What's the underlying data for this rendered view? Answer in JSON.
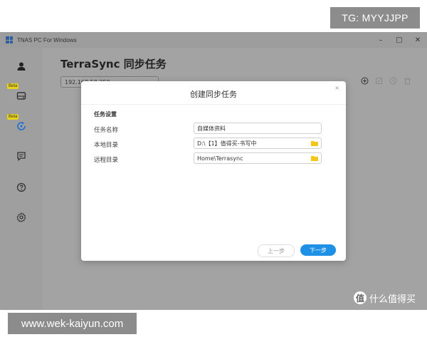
{
  "watermarks": {
    "top": "TG: MYYJJPP",
    "bottom": "www.wek-kaiyun.com",
    "brand": "什么值得买",
    "brand_logo": "值"
  },
  "window": {
    "title": "TNAS PC For Windows",
    "controls": {
      "minimize": "–",
      "maximize": "□",
      "close": "✕"
    }
  },
  "sidebar": {
    "items": [
      {
        "icon": "user-icon",
        "beta": ""
      },
      {
        "icon": "drive-icon",
        "beta": "Beta"
      },
      {
        "icon": "sync-icon",
        "beta": "Beta"
      },
      {
        "icon": "message-icon",
        "beta": ""
      },
      {
        "icon": "help-icon",
        "beta": ""
      },
      {
        "icon": "gear-icon",
        "beta": ""
      }
    ]
  },
  "main": {
    "title": "TerraSync 同步任务",
    "ip": "192.168.50.250",
    "toolbar": [
      "add-icon",
      "edit-icon",
      "history-icon",
      "delete-icon"
    ]
  },
  "modal": {
    "title": "创建同步任务",
    "close": "×",
    "section": "任务设置",
    "fields": [
      {
        "label": "任务名称",
        "value": "自媒体资料"
      },
      {
        "label": "本地目录",
        "value": "D:\\【1】值得买-书写中"
      },
      {
        "label": "远程目录",
        "value": "Home\\Terrasync"
      }
    ],
    "prev_label": "上一步",
    "next_label": "下一步"
  },
  "colors": {
    "primary": "#1e90e6",
    "folder": "#f5c518",
    "overlay": "#a1a1a1"
  }
}
